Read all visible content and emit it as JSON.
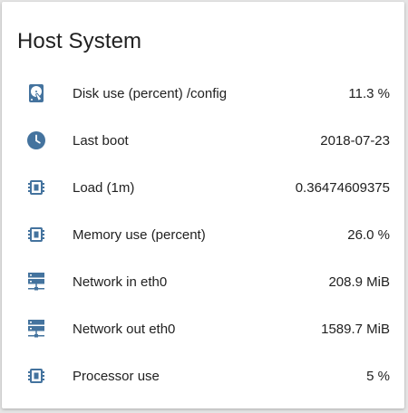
{
  "card": {
    "title": "Host System"
  },
  "icon_color": "#44739e",
  "rows": [
    {
      "icon": "harddisk-icon",
      "label": "Disk use (percent) /config",
      "value": "11.3 %"
    },
    {
      "icon": "clock-icon",
      "label": "Last boot",
      "value": "2018-07-23"
    },
    {
      "icon": "chip-icon",
      "label": "Load (1m)",
      "value": "0.36474609375"
    },
    {
      "icon": "chip-icon",
      "label": "Memory use (percent)",
      "value": "26.0 %"
    },
    {
      "icon": "server-network-icon",
      "label": "Network in eth0",
      "value": "208.9 MiB"
    },
    {
      "icon": "server-network-icon",
      "label": "Network out eth0",
      "value": "1589.7 MiB"
    },
    {
      "icon": "chip-icon",
      "label": "Processor use",
      "value": "5 %"
    }
  ]
}
